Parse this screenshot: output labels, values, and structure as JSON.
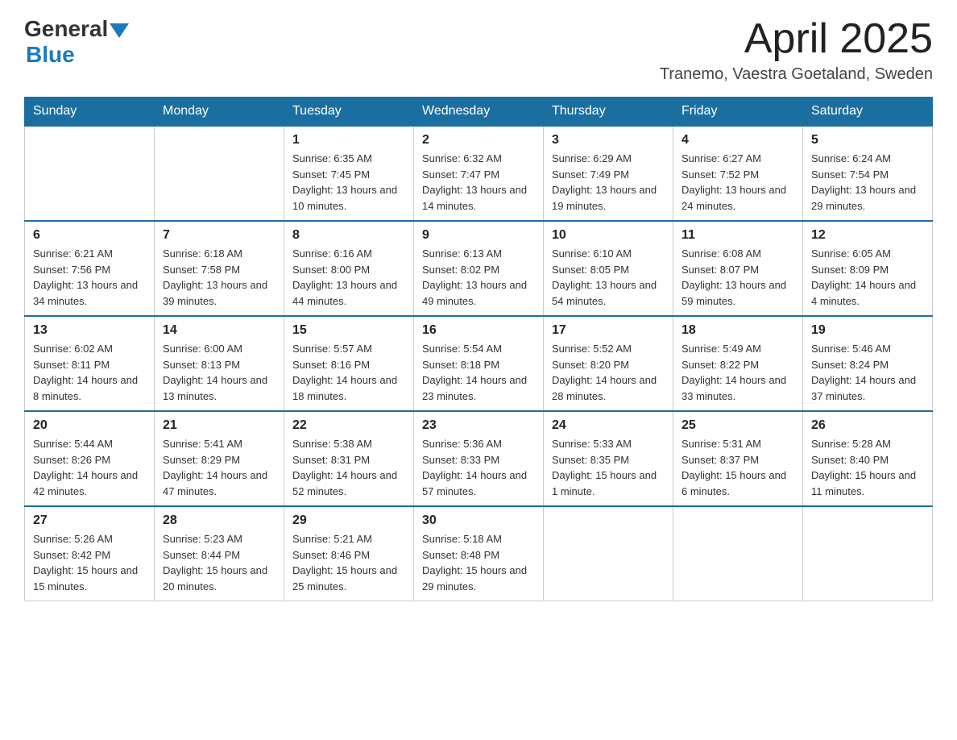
{
  "header": {
    "logo": {
      "general": "General",
      "blue": "Blue"
    },
    "title": "April 2025",
    "location": "Tranemo, Vaestra Goetaland, Sweden"
  },
  "calendar": {
    "days_of_week": [
      "Sunday",
      "Monday",
      "Tuesday",
      "Wednesday",
      "Thursday",
      "Friday",
      "Saturday"
    ],
    "weeks": [
      [
        {
          "day": "",
          "sunrise": "",
          "sunset": "",
          "daylight": ""
        },
        {
          "day": "",
          "sunrise": "",
          "sunset": "",
          "daylight": ""
        },
        {
          "day": "1",
          "sunrise": "Sunrise: 6:35 AM",
          "sunset": "Sunset: 7:45 PM",
          "daylight": "Daylight: 13 hours and 10 minutes."
        },
        {
          "day": "2",
          "sunrise": "Sunrise: 6:32 AM",
          "sunset": "Sunset: 7:47 PM",
          "daylight": "Daylight: 13 hours and 14 minutes."
        },
        {
          "day": "3",
          "sunrise": "Sunrise: 6:29 AM",
          "sunset": "Sunset: 7:49 PM",
          "daylight": "Daylight: 13 hours and 19 minutes."
        },
        {
          "day": "4",
          "sunrise": "Sunrise: 6:27 AM",
          "sunset": "Sunset: 7:52 PM",
          "daylight": "Daylight: 13 hours and 24 minutes."
        },
        {
          "day": "5",
          "sunrise": "Sunrise: 6:24 AM",
          "sunset": "Sunset: 7:54 PM",
          "daylight": "Daylight: 13 hours and 29 minutes."
        }
      ],
      [
        {
          "day": "6",
          "sunrise": "Sunrise: 6:21 AM",
          "sunset": "Sunset: 7:56 PM",
          "daylight": "Daylight: 13 hours and 34 minutes."
        },
        {
          "day": "7",
          "sunrise": "Sunrise: 6:18 AM",
          "sunset": "Sunset: 7:58 PM",
          "daylight": "Daylight: 13 hours and 39 minutes."
        },
        {
          "day": "8",
          "sunrise": "Sunrise: 6:16 AM",
          "sunset": "Sunset: 8:00 PM",
          "daylight": "Daylight: 13 hours and 44 minutes."
        },
        {
          "day": "9",
          "sunrise": "Sunrise: 6:13 AM",
          "sunset": "Sunset: 8:02 PM",
          "daylight": "Daylight: 13 hours and 49 minutes."
        },
        {
          "day": "10",
          "sunrise": "Sunrise: 6:10 AM",
          "sunset": "Sunset: 8:05 PM",
          "daylight": "Daylight: 13 hours and 54 minutes."
        },
        {
          "day": "11",
          "sunrise": "Sunrise: 6:08 AM",
          "sunset": "Sunset: 8:07 PM",
          "daylight": "Daylight: 13 hours and 59 minutes."
        },
        {
          "day": "12",
          "sunrise": "Sunrise: 6:05 AM",
          "sunset": "Sunset: 8:09 PM",
          "daylight": "Daylight: 14 hours and 4 minutes."
        }
      ],
      [
        {
          "day": "13",
          "sunrise": "Sunrise: 6:02 AM",
          "sunset": "Sunset: 8:11 PM",
          "daylight": "Daylight: 14 hours and 8 minutes."
        },
        {
          "day": "14",
          "sunrise": "Sunrise: 6:00 AM",
          "sunset": "Sunset: 8:13 PM",
          "daylight": "Daylight: 14 hours and 13 minutes."
        },
        {
          "day": "15",
          "sunrise": "Sunrise: 5:57 AM",
          "sunset": "Sunset: 8:16 PM",
          "daylight": "Daylight: 14 hours and 18 minutes."
        },
        {
          "day": "16",
          "sunrise": "Sunrise: 5:54 AM",
          "sunset": "Sunset: 8:18 PM",
          "daylight": "Daylight: 14 hours and 23 minutes."
        },
        {
          "day": "17",
          "sunrise": "Sunrise: 5:52 AM",
          "sunset": "Sunset: 8:20 PM",
          "daylight": "Daylight: 14 hours and 28 minutes."
        },
        {
          "day": "18",
          "sunrise": "Sunrise: 5:49 AM",
          "sunset": "Sunset: 8:22 PM",
          "daylight": "Daylight: 14 hours and 33 minutes."
        },
        {
          "day": "19",
          "sunrise": "Sunrise: 5:46 AM",
          "sunset": "Sunset: 8:24 PM",
          "daylight": "Daylight: 14 hours and 37 minutes."
        }
      ],
      [
        {
          "day": "20",
          "sunrise": "Sunrise: 5:44 AM",
          "sunset": "Sunset: 8:26 PM",
          "daylight": "Daylight: 14 hours and 42 minutes."
        },
        {
          "day": "21",
          "sunrise": "Sunrise: 5:41 AM",
          "sunset": "Sunset: 8:29 PM",
          "daylight": "Daylight: 14 hours and 47 minutes."
        },
        {
          "day": "22",
          "sunrise": "Sunrise: 5:38 AM",
          "sunset": "Sunset: 8:31 PM",
          "daylight": "Daylight: 14 hours and 52 minutes."
        },
        {
          "day": "23",
          "sunrise": "Sunrise: 5:36 AM",
          "sunset": "Sunset: 8:33 PM",
          "daylight": "Daylight: 14 hours and 57 minutes."
        },
        {
          "day": "24",
          "sunrise": "Sunrise: 5:33 AM",
          "sunset": "Sunset: 8:35 PM",
          "daylight": "Daylight: 15 hours and 1 minute."
        },
        {
          "day": "25",
          "sunrise": "Sunrise: 5:31 AM",
          "sunset": "Sunset: 8:37 PM",
          "daylight": "Daylight: 15 hours and 6 minutes."
        },
        {
          "day": "26",
          "sunrise": "Sunrise: 5:28 AM",
          "sunset": "Sunset: 8:40 PM",
          "daylight": "Daylight: 15 hours and 11 minutes."
        }
      ],
      [
        {
          "day": "27",
          "sunrise": "Sunrise: 5:26 AM",
          "sunset": "Sunset: 8:42 PM",
          "daylight": "Daylight: 15 hours and 15 minutes."
        },
        {
          "day": "28",
          "sunrise": "Sunrise: 5:23 AM",
          "sunset": "Sunset: 8:44 PM",
          "daylight": "Daylight: 15 hours and 20 minutes."
        },
        {
          "day": "29",
          "sunrise": "Sunrise: 5:21 AM",
          "sunset": "Sunset: 8:46 PM",
          "daylight": "Daylight: 15 hours and 25 minutes."
        },
        {
          "day": "30",
          "sunrise": "Sunrise: 5:18 AM",
          "sunset": "Sunset: 8:48 PM",
          "daylight": "Daylight: 15 hours and 29 minutes."
        },
        {
          "day": "",
          "sunrise": "",
          "sunset": "",
          "daylight": ""
        },
        {
          "day": "",
          "sunrise": "",
          "sunset": "",
          "daylight": ""
        },
        {
          "day": "",
          "sunrise": "",
          "sunset": "",
          "daylight": ""
        }
      ]
    ]
  }
}
